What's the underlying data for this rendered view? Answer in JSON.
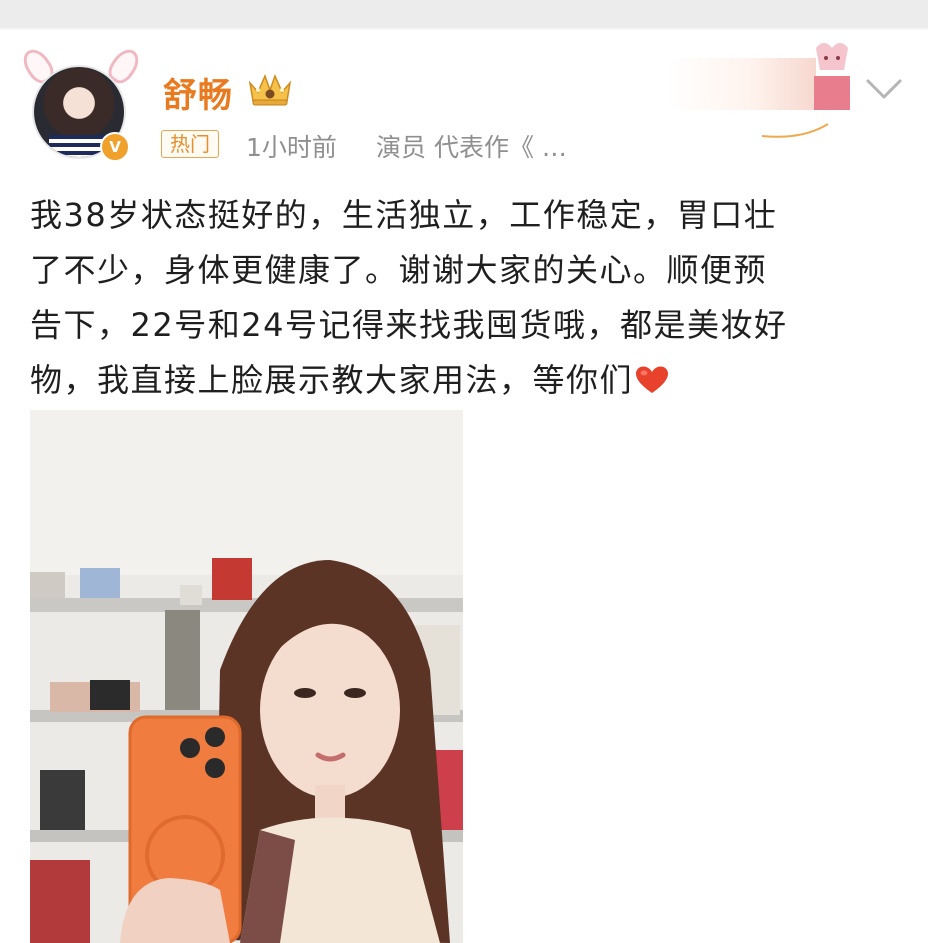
{
  "post": {
    "author": {
      "name": "舒畅",
      "avatar_icon": "avatar-with-bunny-ears",
      "verified_badge_icon": "verified-v-icon",
      "verified_badge_text": "V",
      "crown_icon": "crown-icon"
    },
    "hot_tag": "热门",
    "time": "1小时前",
    "role": "演员  代表作《 …",
    "menu_icon": "chevron-down-icon",
    "text_lines": [
      "我38岁状态挺好的，生活独立，工作稳定，胃口壮",
      "了不少，身体更健康了。谢谢大家的关心。顺便预",
      "告下，22号和24号记得来找我囤货哦，都是美妆好",
      "物，我直接上脸展示教大家用法，等你们"
    ],
    "trailing_emoji": "heart-emoji",
    "photo_icon": "selfie-photo"
  },
  "colors": {
    "username": "#ea7a1f",
    "meta": "#8f8f8f",
    "hot_tag_border": "#e7a556",
    "text": "#1f1f1f",
    "heart": "#e8412c",
    "phone_case": "#f07c3f"
  }
}
